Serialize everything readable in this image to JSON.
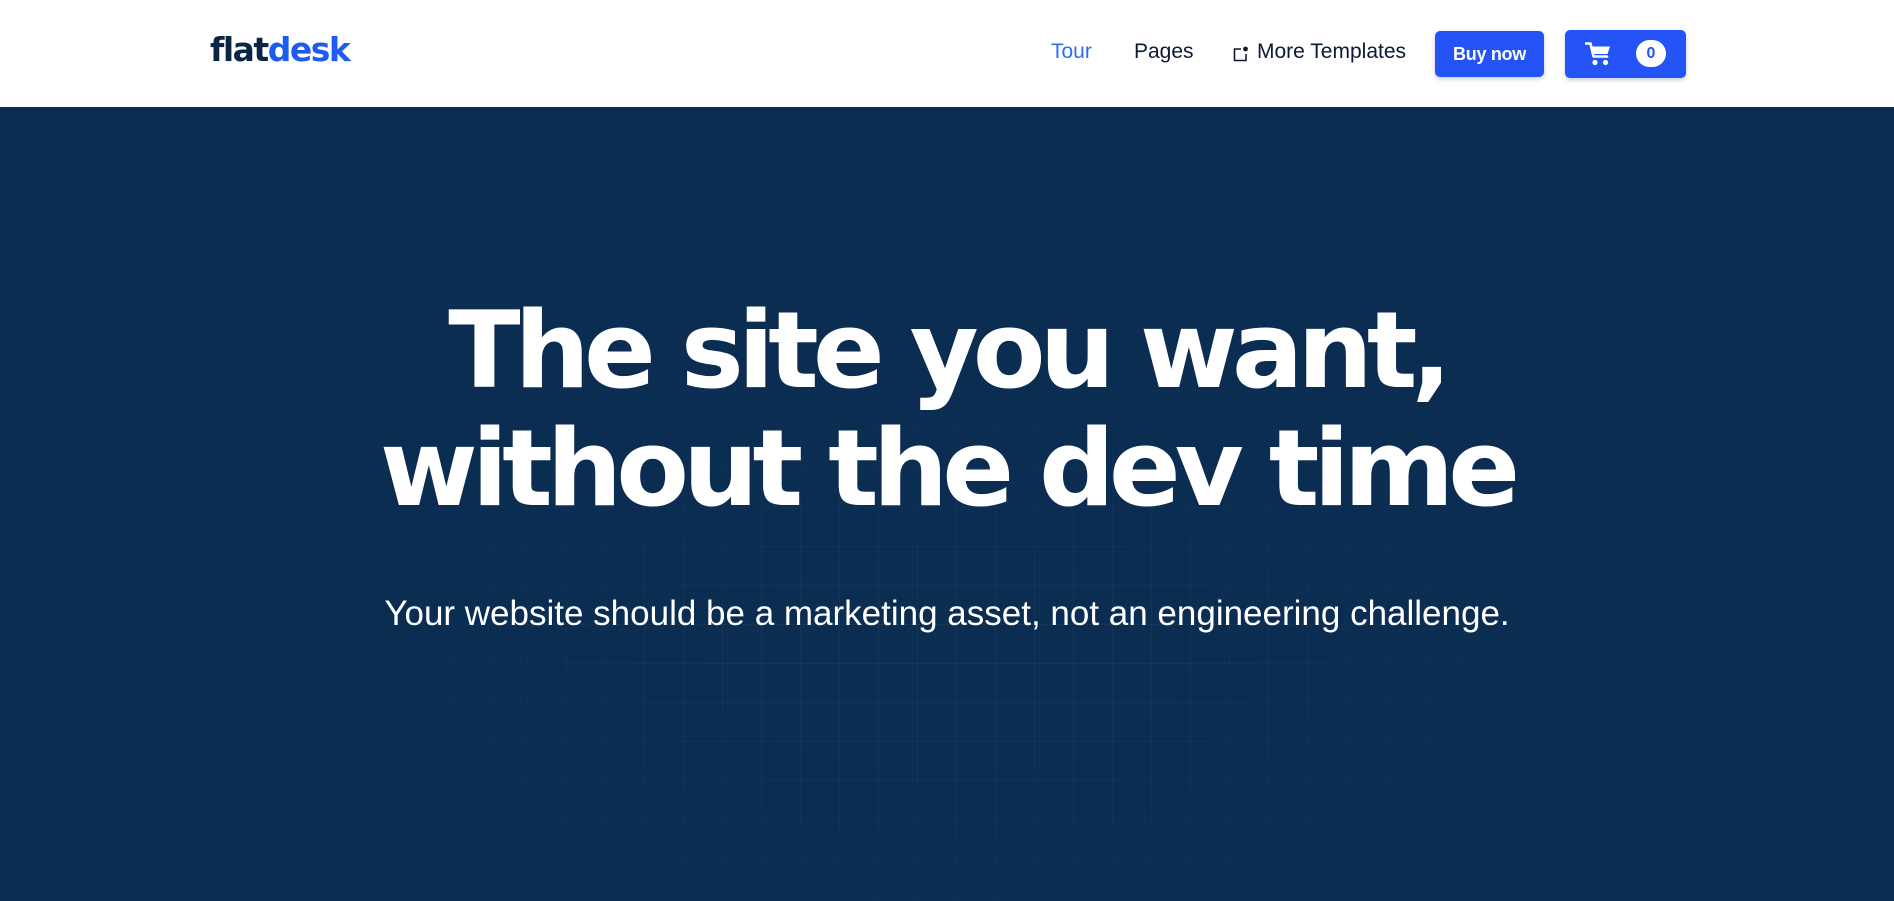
{
  "navbar": {
    "logo": {
      "part1": "flat",
      "part2": "desk"
    },
    "links": [
      {
        "label": "Tour",
        "active": true
      },
      {
        "label": "Pages",
        "active": false
      },
      {
        "label": "More Templates",
        "icon": "external-link-icon"
      }
    ],
    "buy_button": "Buy now",
    "cart": {
      "icon": "cart-icon",
      "count": "0"
    }
  },
  "hero": {
    "title_line1": "The site you want,",
    "title_line2": "without the dev time",
    "subtitle": "Your website should be a marketing asset, not an engineering challenge."
  },
  "colors": {
    "navbar_bg": "#ffffff",
    "hero_bg": "#0b2d52",
    "primary_button": "#2454f5",
    "active_link": "#2f6df0",
    "logo_dark": "#0b2545",
    "logo_accent": "#1d5cf0"
  }
}
